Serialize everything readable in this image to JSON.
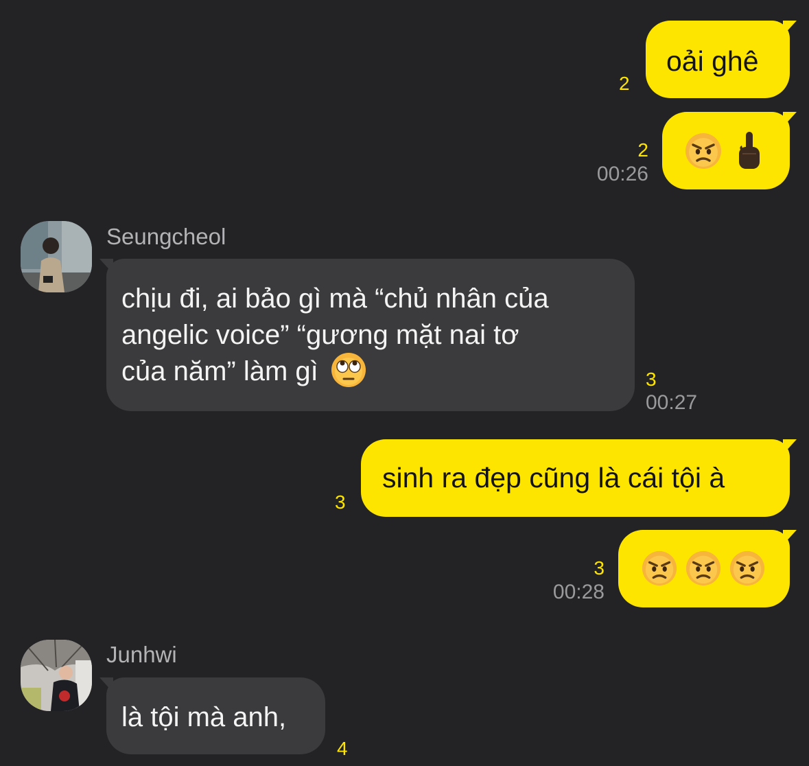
{
  "messages": [
    {
      "id": "m1",
      "direction": "out",
      "text": "oải ghê",
      "unread": "2",
      "time": ""
    },
    {
      "id": "m2",
      "direction": "out",
      "emojis": [
        "angry-face",
        "middle-finger"
      ],
      "unread": "2",
      "time": "00:26"
    },
    {
      "id": "m3",
      "direction": "in",
      "sender": "Seungcheol",
      "lines": [
        "chịu đi, ai bảo gì mà “chủ nhân của",
        "angelic voice” “gương mặt nai tơ",
        "của năm” làm gì"
      ],
      "trailing_emoji": "rolling-eyes-face",
      "unread": "3",
      "time": "00:27"
    },
    {
      "id": "m4",
      "direction": "out",
      "text": "sinh ra đẹp cũng là cái tội à",
      "unread": "3",
      "time": ""
    },
    {
      "id": "m5",
      "direction": "out",
      "emojis": [
        "angry-face",
        "angry-face",
        "angry-face"
      ],
      "unread": "3",
      "time": "00:28"
    },
    {
      "id": "m6",
      "direction": "in",
      "sender": "Junhwi",
      "text": "là tội mà anh,",
      "unread": "4",
      "time": ""
    }
  ],
  "colors": {
    "background": "#232326",
    "outgoing_bubble": "#fee500",
    "incoming_bubble": "#3b3b3d",
    "unread_count": "#fee500",
    "timestamp": "#9a9a9c",
    "sender_name": "#b3b3b6"
  }
}
